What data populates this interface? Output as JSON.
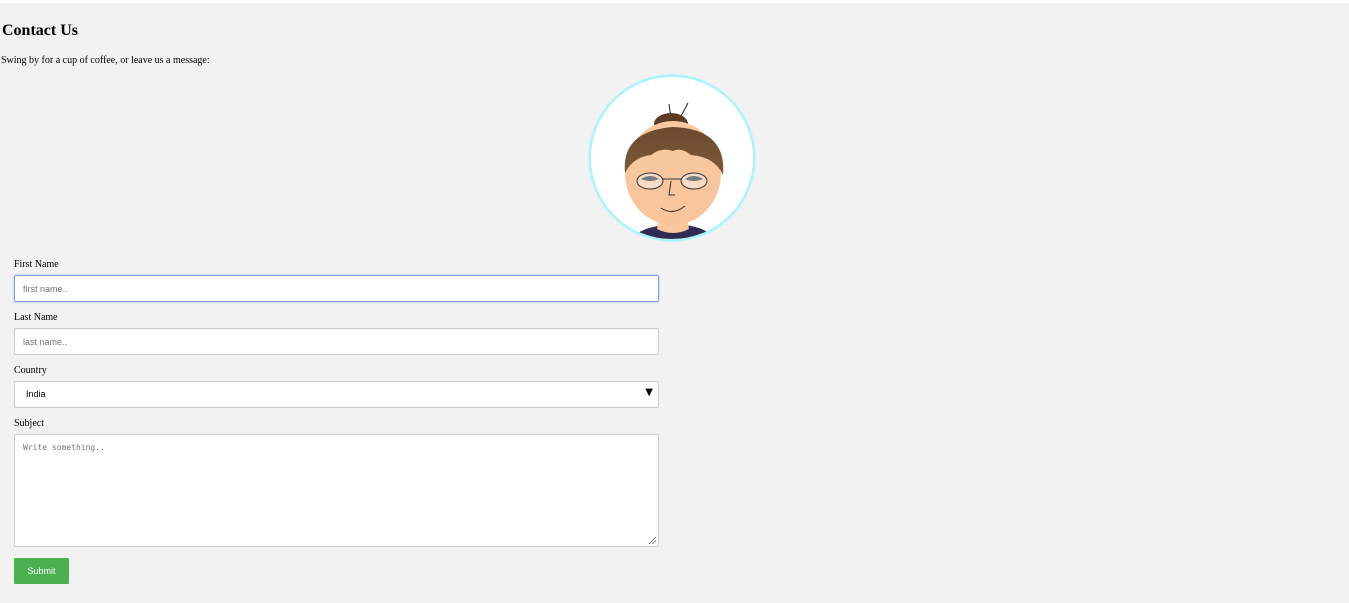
{
  "page": {
    "title": "Contact Us",
    "intro": "Swing by for a cup of coffee, or leave us a message:"
  },
  "form": {
    "first_name": {
      "label": "First Name",
      "placeholder": "first name..",
      "value": ""
    },
    "last_name": {
      "label": "Last Name",
      "placeholder": "last name..",
      "value": ""
    },
    "country": {
      "label": "Country",
      "selected": "India"
    },
    "subject": {
      "label": "Subject",
      "placeholder": "Write something..",
      "value": ""
    },
    "submit_label": "Submit"
  },
  "colors": {
    "background": "#f2f2f2",
    "submit_button": "#4caf50",
    "focus_border": "#7aa7e6",
    "avatar_ring": "#aef2f7"
  },
  "icons": {
    "avatar": "woman-with-bun-and-glasses-avatar",
    "select_arrow": "caret-down-icon",
    "resize_grip": "resize-handle-icon"
  }
}
